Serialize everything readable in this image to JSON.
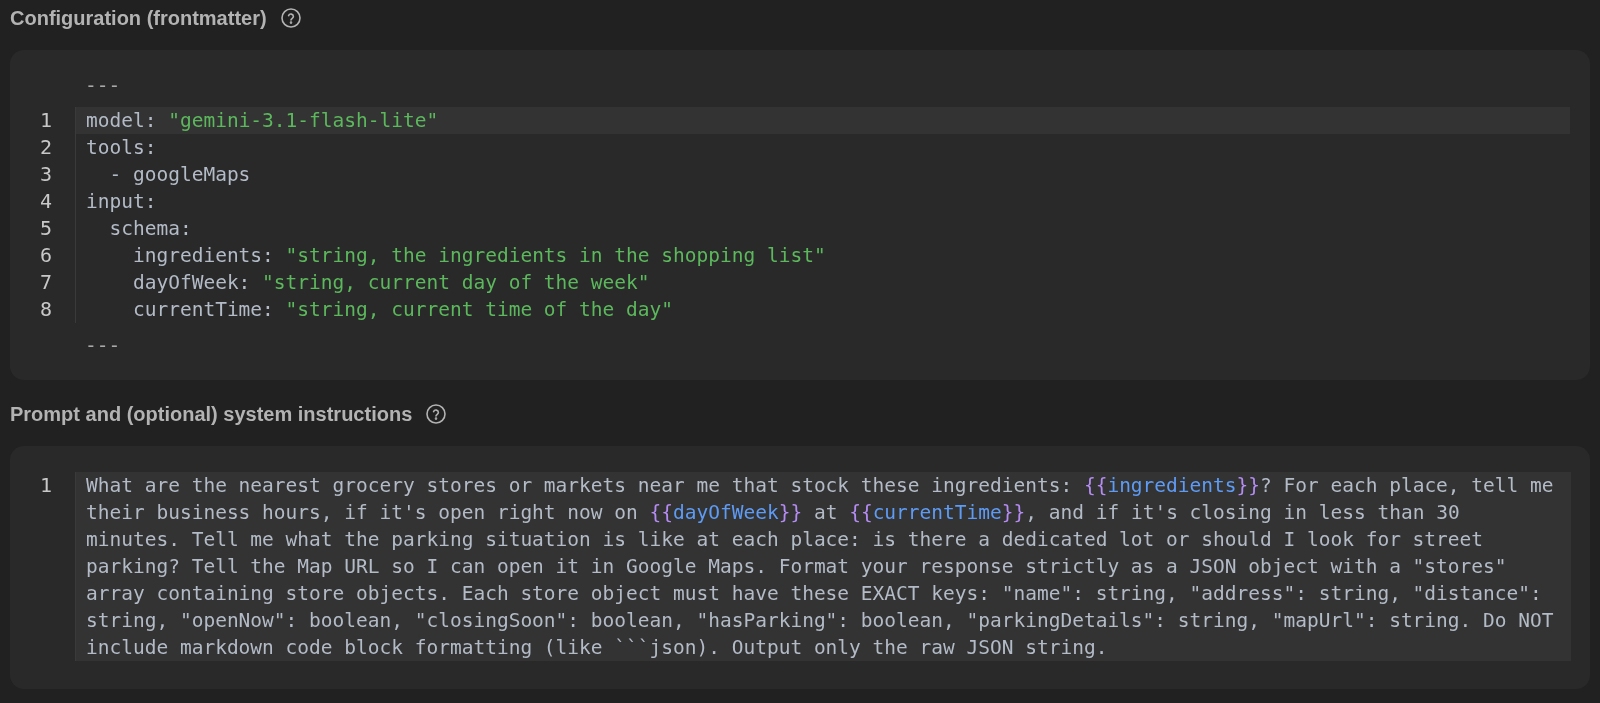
{
  "sections": [
    {
      "kind": "yaml",
      "title": "Configuration (frontmatter)",
      "editor": {
        "open_delimiter": "---",
        "close_delimiter": "---",
        "lines": [
          {
            "number": "1",
            "selected": true,
            "tokens": [
              {
                "kind": "plain",
                "text": "model: "
              },
              {
                "kind": "string",
                "text": "\"gemini-3.1-flash-lite\""
              }
            ]
          },
          {
            "number": "2",
            "selected": false,
            "tokens": [
              {
                "kind": "plain",
                "text": "tools:"
              }
            ]
          },
          {
            "number": "3",
            "selected": false,
            "tokens": [
              {
                "kind": "plain",
                "text": "  - googleMaps"
              }
            ]
          },
          {
            "number": "4",
            "selected": false,
            "tokens": [
              {
                "kind": "plain",
                "text": "input:"
              }
            ]
          },
          {
            "number": "5",
            "selected": false,
            "tokens": [
              {
                "kind": "plain",
                "text": "  schema:"
              }
            ]
          },
          {
            "number": "6",
            "selected": false,
            "tokens": [
              {
                "kind": "plain",
                "text": "    ingredients: "
              },
              {
                "kind": "string",
                "text": "\"string, the ingredients in the shopping list\""
              }
            ]
          },
          {
            "number": "7",
            "selected": false,
            "tokens": [
              {
                "kind": "plain",
                "text": "    dayOfWeek: "
              },
              {
                "kind": "string",
                "text": "\"string, current day of the week\""
              }
            ]
          },
          {
            "number": "8",
            "selected": false,
            "tokens": [
              {
                "kind": "plain",
                "text": "    currentTime: "
              },
              {
                "kind": "string",
                "text": "\"string, current time of the day\""
              }
            ]
          }
        ]
      }
    },
    {
      "kind": "prompt",
      "title": "Prompt and (optional) system instructions",
      "editor": {
        "lines": [
          {
            "number": "1",
            "selected": true,
            "tokens": [
              {
                "kind": "plain",
                "text": "What are the nearest grocery stores or markets near me that stock these ingredients: "
              },
              {
                "kind": "brace",
                "text": "{{"
              },
              {
                "kind": "variable",
                "text": "ingredients"
              },
              {
                "kind": "brace",
                "text": "}}"
              },
              {
                "kind": "plain",
                "text": "? For each place, tell me their business hours, if it's open right now on "
              },
              {
                "kind": "brace",
                "text": "{{"
              },
              {
                "kind": "variable",
                "text": "dayOfWeek"
              },
              {
                "kind": "brace",
                "text": "}}"
              },
              {
                "kind": "plain",
                "text": " at "
              },
              {
                "kind": "brace",
                "text": "{{"
              },
              {
                "kind": "variable",
                "text": "currentTime"
              },
              {
                "kind": "brace",
                "text": "}}"
              },
              {
                "kind": "plain",
                "text": ", and if it's closing in less than 30 minutes. Tell me what the parking situation is like at each place: is there a dedicated lot or should I look for street parking? Tell the Map URL so I can open it in Google Maps. Format your response strictly as a JSON object with a \"stores\" array containing store objects. Each store object must have these EXACT keys: \"name\": string, \"address\": string, \"distance\": string, \"openNow\": boolean, \"closingSoon\": boolean, \"hasParking\": boolean, \"parkingDetails\": string, \"mapUrl\": string. Do NOT include markdown code block formatting (like ```json). Output only the raw JSON string."
              }
            ]
          }
        ]
      }
    }
  ]
}
